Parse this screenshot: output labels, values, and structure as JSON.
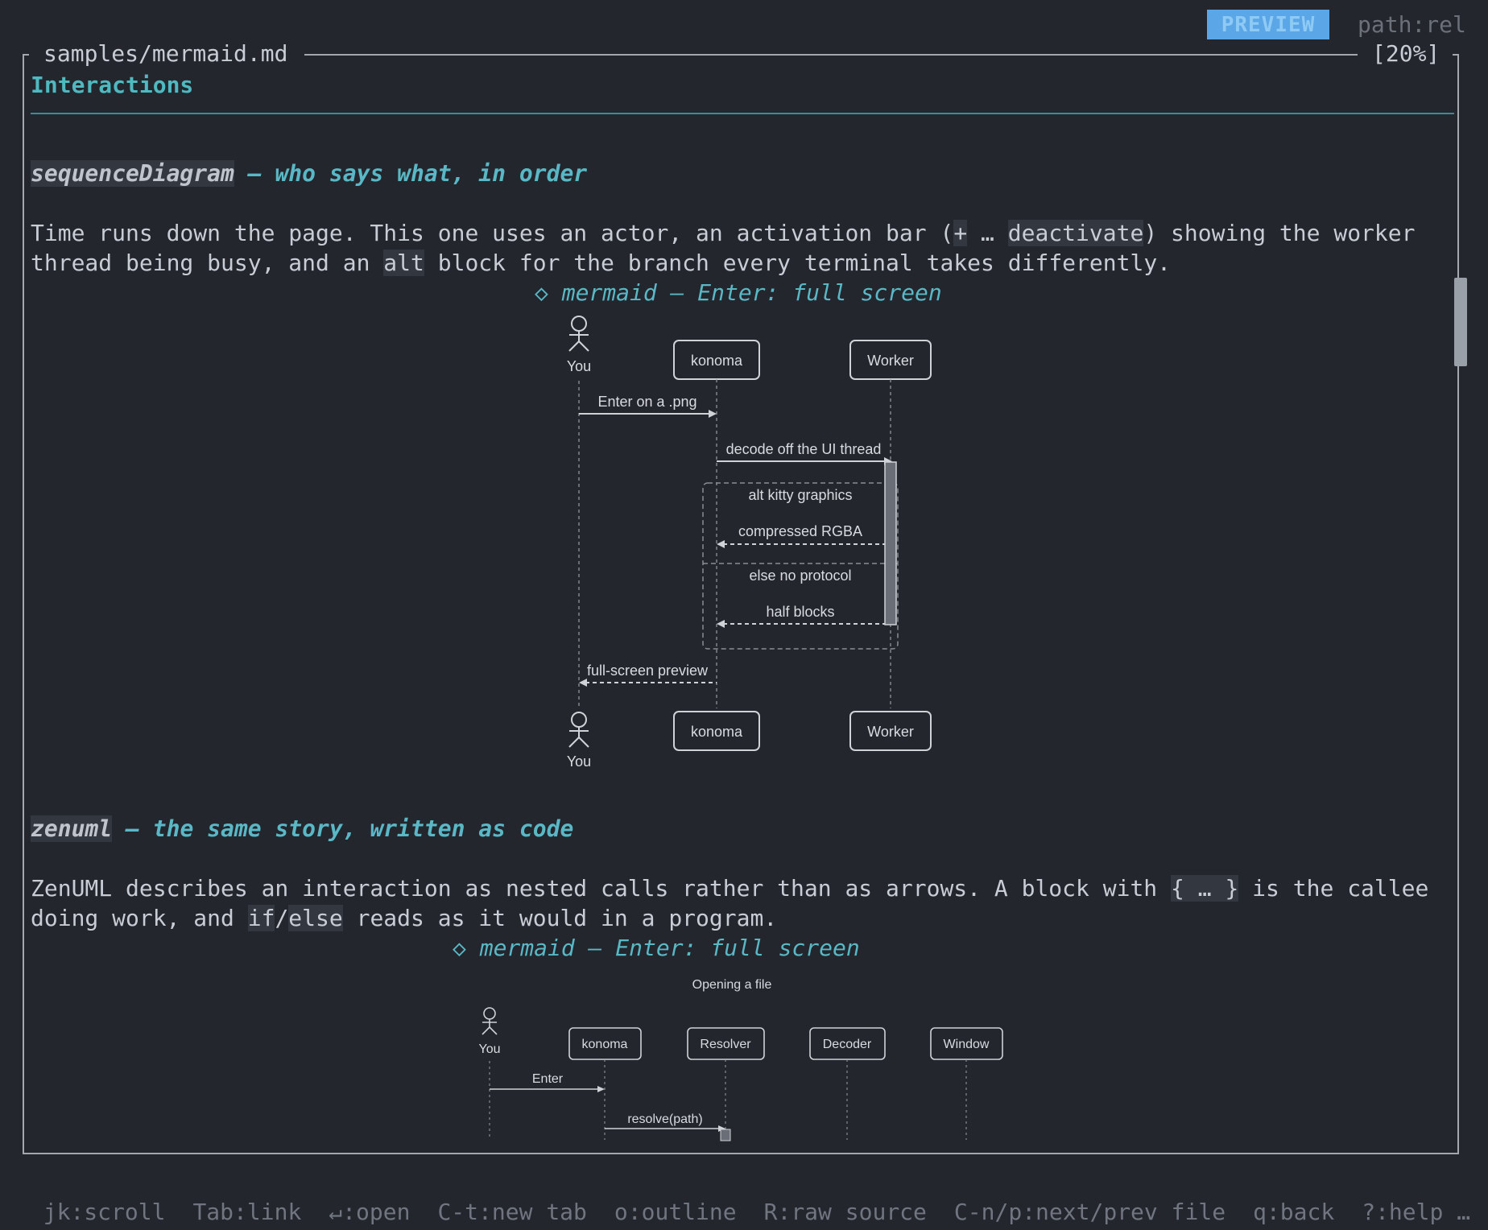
{
  "mode_badge": "PREVIEW",
  "path_mode": "path:rel",
  "file_title": "samples/mermaid.md",
  "scroll_percent": "[20%]",
  "heading": "Interactions",
  "section1": {
    "code": "sequenceDiagram",
    "title_rest": " — who says what, in order",
    "para_l1_a": "Time runs down the page. This one uses an actor, an activation bar (",
    "para_l1_code1": "+",
    "para_l1_b": " … ",
    "para_l1_code2": "deactivate",
    "para_l1_c": ") showing the worker",
    "para_l2_a": "thread being busy, and an ",
    "para_l2_code": "alt",
    "para_l2_b": " block for the branch every terminal takes differently.",
    "caption": "◇ mermaid — Enter: full screen",
    "diagram": {
      "actor_you": "You",
      "p_konoma": "konoma",
      "p_worker": "Worker",
      "msg1": "Enter on a .png",
      "msg2": "decode off the UI thread",
      "alt_label": "alt kitty graphics",
      "msg3": "compressed RGBA",
      "else_label": "else no protocol",
      "msg4": "half blocks",
      "msg5": "full-screen preview"
    }
  },
  "section2": {
    "code": "zenuml",
    "title_rest": " — the same story, written as code",
    "para_l1_a": "ZenUML describes an interaction as nested calls rather than as arrows. A block with ",
    "para_l1_code": "{ … }",
    "para_l1_b": " is the callee",
    "para_l2_a": "doing work, and ",
    "para_l2_code1": "if",
    "para_l2_sep": "/",
    "para_l2_code2": "else",
    "para_l2_b": " reads as it would in a program.",
    "caption": "◇ mermaid — Enter: full screen",
    "diagram": {
      "title": "Opening a file",
      "actor_you": "You",
      "p_konoma": "konoma",
      "p_resolver": "Resolver",
      "p_decoder": "Decoder",
      "p_window": "Window",
      "msg1": "Enter",
      "msg2": "resolve(path)"
    }
  },
  "footer": [
    "jk:scroll",
    "Tab:link",
    "↵:open",
    "C-t:new tab",
    "o:outline",
    "R:raw source",
    "C-n/p:next/prev file",
    "q:back",
    "?:help …"
  ],
  "colors": {
    "accent": "#5ab7c5",
    "badge": "#5aa6e6",
    "background": "#23262c"
  }
}
